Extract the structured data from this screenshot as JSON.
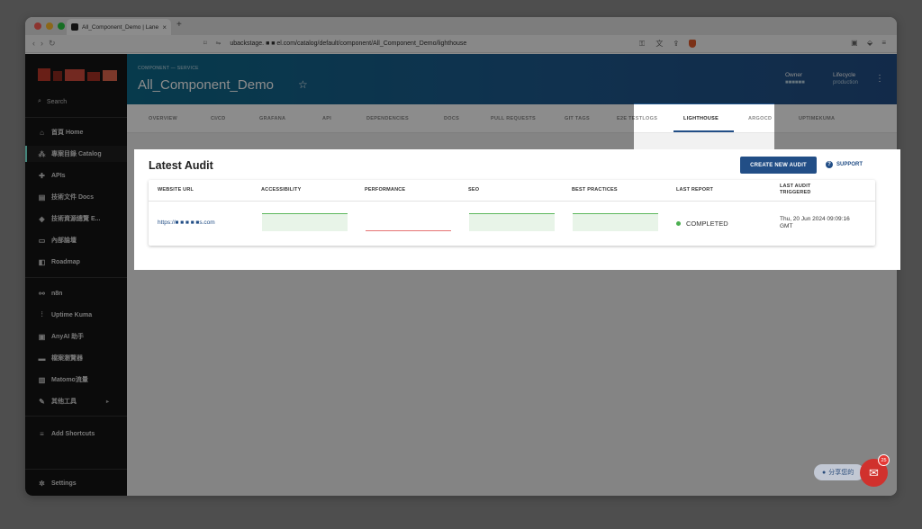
{
  "browser": {
    "tab_title": "All_Component_Demo | Lane",
    "url": "ubackstage.  ■ ■ el.com/catalog/default/component/All_Component_Demo/lighthouse"
  },
  "sidebar": {
    "search_label": "Search",
    "items": [
      {
        "label": "首頁 Home",
        "icon": "home-icon"
      },
      {
        "label": "專案目錄 Catalog",
        "icon": "catalog-icon"
      },
      {
        "label": "APIs",
        "icon": "puzzle-icon"
      },
      {
        "label": "技術文件 Docs",
        "icon": "docs-icon"
      },
      {
        "label": "技術資源總覽 E...",
        "icon": "layers-icon"
      },
      {
        "label": "內部論壇",
        "icon": "forum-icon"
      },
      {
        "label": "Roadmap",
        "icon": "roadmap-icon"
      },
      {
        "label": "n8n",
        "icon": "n8n-icon"
      },
      {
        "label": "Uptime Kuma",
        "icon": "pulse-icon"
      },
      {
        "label": "AnyAI 助手",
        "icon": "robot-icon"
      },
      {
        "label": "檔案瀏覽器",
        "icon": "folder-icon"
      },
      {
        "label": "Matomo流量",
        "icon": "analytics-icon"
      },
      {
        "label": "其他工具",
        "icon": "wrench-icon"
      }
    ],
    "add_shortcuts": "Add Shortcuts",
    "settings": "Settings"
  },
  "header": {
    "breadcrumb": "COMPONENT — SERVICE",
    "title": "All_Component_Demo",
    "owner_label": "Owner",
    "owner_value": "■■■■■■",
    "lifecycle_label": "Lifecycle",
    "lifecycle_value": "production"
  },
  "tabs": [
    "OVERVIEW",
    "CI/CD",
    "GRAFANA",
    "API",
    "DEPENDENCIES",
    "DOCS",
    "PULL REQUESTS",
    "GIT TAGS",
    "E2E TESTLOGS",
    "LIGHTHOUSE",
    "ARGOCD",
    "UPTIMEKUMA"
  ],
  "active_tab": "LIGHTHOUSE",
  "audit": {
    "title": "Latest Audit",
    "create_button": "CREATE NEW AUDIT",
    "support": "SUPPORT",
    "columns": [
      "WEBSITE URL",
      "ACCESSIBILITY",
      "PERFORMANCE",
      "SEO",
      "BEST PRACTICES",
      "LAST REPORT",
      "LAST AUDIT TRIGGERED"
    ],
    "row": {
      "url": "https://■ ■ ■ ■ ■s.com",
      "status": "COMPLETED",
      "date_line1": "Thu, 20 Jun 2024 09:09:16",
      "date_line2": "GMT"
    }
  },
  "chat": {
    "pill_label": "分享您的",
    "badge": "25"
  },
  "colors": {
    "accent": "#224e86",
    "sidebar_bg": "#151515",
    "status_ok": "#4caf50",
    "score_good": "#5cb85c",
    "score_bad": "#e57373"
  }
}
